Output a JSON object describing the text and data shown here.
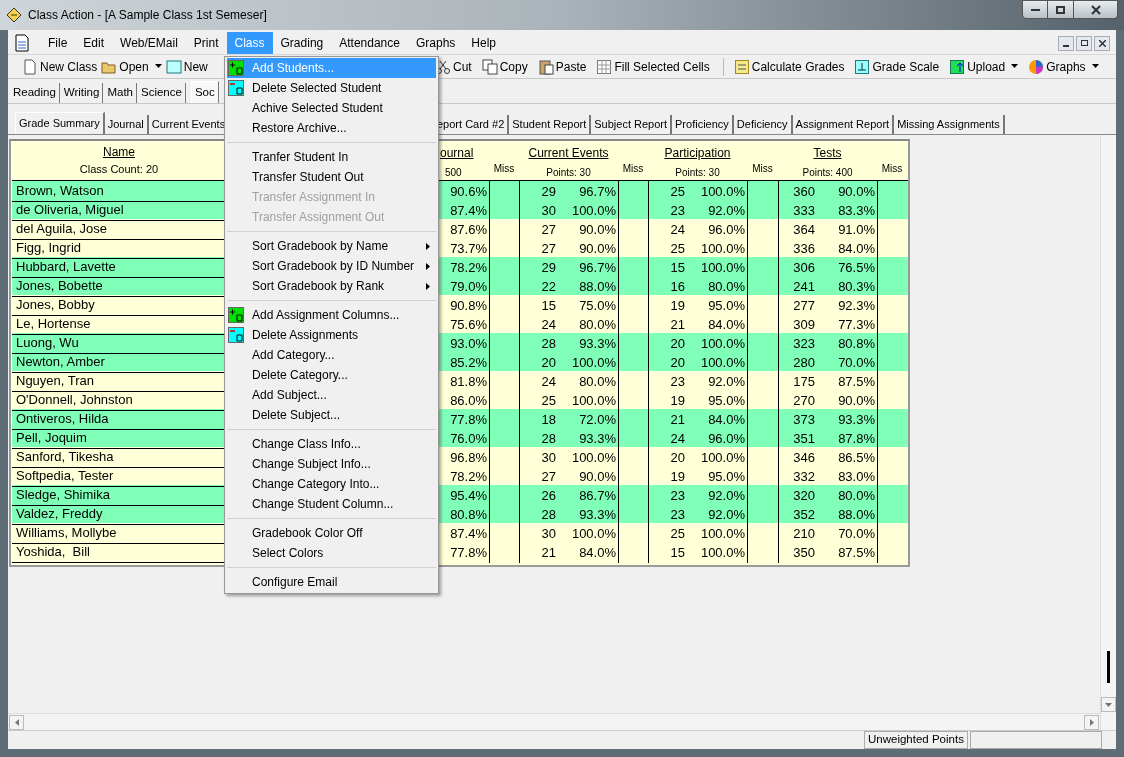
{
  "window": {
    "title": "Class Action - [A Sample Class 1st Semeser]"
  },
  "menubar": [
    {
      "label": "File",
      "selected": false
    },
    {
      "label": "Edit",
      "selected": false
    },
    {
      "label": "Web/EMail",
      "selected": false
    },
    {
      "label": "Print",
      "selected": false
    },
    {
      "label": "Class",
      "selected": true
    },
    {
      "label": "Grading",
      "selected": false
    },
    {
      "label": "Attendance",
      "selected": false
    },
    {
      "label": "Graphs",
      "selected": false
    },
    {
      "label": "Help",
      "selected": false
    }
  ],
  "toolbar": [
    {
      "kind": "button",
      "label": "New Class"
    },
    {
      "kind": "dropdown",
      "label": "Open"
    },
    {
      "kind": "button",
      "label": "New"
    },
    {
      "kind": "button",
      "label": "Cut"
    },
    {
      "kind": "button",
      "label": "Copy"
    },
    {
      "kind": "button",
      "label": "Paste"
    },
    {
      "kind": "button",
      "label": "Fill Selected Cells"
    },
    {
      "kind": "separator"
    },
    {
      "kind": "button",
      "label": "Calculate Grades"
    },
    {
      "kind": "button",
      "label": "Grade Scale"
    },
    {
      "kind": "dropdown",
      "label": "Upload"
    },
    {
      "kind": "dropdown",
      "label": "Graphs"
    }
  ],
  "subject_tabs": [
    {
      "label": "Reading",
      "selected": false
    },
    {
      "label": "Writing",
      "selected": false
    },
    {
      "label": "Math",
      "selected": false
    },
    {
      "label": "Science",
      "selected": false
    },
    {
      "label": "Soc",
      "selected": true
    }
  ],
  "report_tabs": [
    {
      "label": "Grade Summary",
      "selected": true
    },
    {
      "label": "Journal",
      "selected": false
    },
    {
      "label": "Current Events",
      "selected": false
    },
    {
      "label": "eport Card #2",
      "selected": false
    },
    {
      "label": "Student Report",
      "selected": false
    },
    {
      "label": "Subject Report",
      "selected": false
    },
    {
      "label": "Proficiency",
      "selected": false
    },
    {
      "label": "Deficiency",
      "selected": false
    },
    {
      "label": "Assignment Report",
      "selected": false
    },
    {
      "label": "Missing Assignments",
      "selected": false
    }
  ],
  "gradebook": {
    "name_header": "Name",
    "class_count": "Class Count: 20",
    "groups": [
      {
        "title": "ournal",
        "points": "500",
        "miss": "Miss"
      },
      {
        "title": "Current Events",
        "points": "Points: 30",
        "miss": "Miss"
      },
      {
        "title": "Participation",
        "points": "Points: 30",
        "miss": "Miss"
      },
      {
        "title": "Tests",
        "points": "Points: 400",
        "miss": "Miss"
      }
    ],
    "rows": [
      {
        "name": "Brown, Watson",
        "color": "#80ffb8",
        "journal_pct": "90.6%",
        "ce": [
          "29",
          "96.7%"
        ],
        "part": [
          "25",
          "100.0%"
        ],
        "tests": [
          "360",
          "90.0%"
        ]
      },
      {
        "name": "de Oliveria, Miguel",
        "color": "#80ffb8",
        "journal_pct": "87.4%",
        "ce": [
          "30",
          "100.0%"
        ],
        "part": [
          "23",
          "92.0%"
        ],
        "tests": [
          "333",
          "83.3%"
        ]
      },
      {
        "name": "del Aguila, Jose",
        "color": "#ffffd8",
        "journal_pct": "87.6%",
        "ce": [
          "27",
          "90.0%"
        ],
        "part": [
          "24",
          "96.0%"
        ],
        "tests": [
          "364",
          "91.0%"
        ]
      },
      {
        "name": "Figg, Ingrid",
        "color": "#ffffd8",
        "journal_pct": "73.7%",
        "ce": [
          "27",
          "90.0%"
        ],
        "part": [
          "25",
          "100.0%"
        ],
        "tests": [
          "336",
          "84.0%"
        ]
      },
      {
        "name": "Hubbard, Lavette",
        "color": "#80ffb8",
        "journal_pct": "78.2%",
        "ce": [
          "29",
          "96.7%"
        ],
        "part": [
          "15",
          "100.0%"
        ],
        "tests": [
          "306",
          "76.5%"
        ]
      },
      {
        "name": "Jones, Bobette",
        "color": "#80ffb8",
        "journal_pct": "79.0%",
        "ce": [
          "22",
          "88.0%"
        ],
        "part": [
          "16",
          "80.0%"
        ],
        "tests": [
          "241",
          "80.3%"
        ]
      },
      {
        "name": "Jones, Bobby",
        "color": "#ffffd8",
        "journal_pct": "90.8%",
        "ce": [
          "15",
          "75.0%"
        ],
        "part": [
          "19",
          "95.0%"
        ],
        "tests": [
          "277",
          "92.3%"
        ]
      },
      {
        "name": "Le, Hortense",
        "color": "#ffffd8",
        "journal_pct": "75.6%",
        "ce": [
          "24",
          "80.0%"
        ],
        "part": [
          "21",
          "84.0%"
        ],
        "tests": [
          "309",
          "77.3%"
        ]
      },
      {
        "name": "Luong, Wu",
        "color": "#80ffb8",
        "journal_pct": "93.0%",
        "ce": [
          "28",
          "93.3%"
        ],
        "part": [
          "20",
          "100.0%"
        ],
        "tests": [
          "323",
          "80.8%"
        ]
      },
      {
        "name": "Newton, Amber",
        "color": "#80ffb8",
        "journal_pct": "85.2%",
        "ce": [
          "20",
          "100.0%"
        ],
        "part": [
          "20",
          "100.0%"
        ],
        "tests": [
          "280",
          "70.0%"
        ]
      },
      {
        "name": "Nguyen, Tran",
        "color": "#ffffd8",
        "journal_pct": "81.8%",
        "ce": [
          "24",
          "80.0%"
        ],
        "part": [
          "23",
          "92.0%"
        ],
        "tests": [
          "175",
          "87.5%"
        ]
      },
      {
        "name": "O'Donnell, Johnston",
        "color": "#ffffd8",
        "journal_pct": "86.0%",
        "ce": [
          "25",
          "100.0%"
        ],
        "part": [
          "19",
          "95.0%"
        ],
        "tests": [
          "270",
          "90.0%"
        ]
      },
      {
        "name": "Ontiveros, Hilda",
        "color": "#80ffb8",
        "journal_pct": "77.8%",
        "ce": [
          "18",
          "72.0%"
        ],
        "part": [
          "21",
          "84.0%"
        ],
        "tests": [
          "373",
          "93.3%"
        ]
      },
      {
        "name": "Pell, Joquim",
        "color": "#80ffb8",
        "journal_pct": "76.0%",
        "ce": [
          "28",
          "93.3%"
        ],
        "part": [
          "24",
          "96.0%"
        ],
        "tests": [
          "351",
          "87.8%"
        ]
      },
      {
        "name": "Sanford, Tikesha",
        "color": "#ffffd8",
        "journal_pct": "96.8%",
        "ce": [
          "30",
          "100.0%"
        ],
        "part": [
          "20",
          "100.0%"
        ],
        "tests": [
          "346",
          "86.5%"
        ]
      },
      {
        "name": "Softpedia, Tester",
        "color": "#ffffd8",
        "journal_pct": "78.2%",
        "ce": [
          "27",
          "90.0%"
        ],
        "part": [
          "19",
          "95.0%"
        ],
        "tests": [
          "332",
          "83.0%"
        ]
      },
      {
        "name": "Sledge, Shimika",
        "color": "#80ffb8",
        "journal_pct": "95.4%",
        "ce": [
          "26",
          "86.7%"
        ],
        "part": [
          "23",
          "92.0%"
        ],
        "tests": [
          "320",
          "80.0%"
        ]
      },
      {
        "name": "Valdez, Freddy",
        "color": "#80ffb8",
        "journal_pct": "80.8%",
        "ce": [
          "28",
          "93.3%"
        ],
        "part": [
          "23",
          "92.0%"
        ],
        "tests": [
          "352",
          "88.0%"
        ]
      },
      {
        "name": "Williams, Mollybe",
        "color": "#ffffd8",
        "journal_pct": "87.4%",
        "ce": [
          "30",
          "100.0%"
        ],
        "part": [
          "25",
          "100.0%"
        ],
        "tests": [
          "210",
          "70.0%"
        ]
      },
      {
        "name": "Yoshida,  Bill",
        "color": "#ffffd8",
        "journal_pct": "77.8%",
        "ce": [
          "21",
          "84.0%"
        ],
        "part": [
          "15",
          "100.0%"
        ],
        "tests": [
          "350",
          "87.5%"
        ]
      }
    ]
  },
  "class_menu": [
    {
      "kind": "item",
      "label": "Add Students...",
      "selected": true,
      "disabled": false,
      "submenu": false
    },
    {
      "kind": "item",
      "label": "Delete Selected Student",
      "selected": false,
      "disabled": false,
      "submenu": false
    },
    {
      "kind": "item",
      "label": "Achive Selected Student",
      "selected": false,
      "disabled": false,
      "submenu": false
    },
    {
      "kind": "item",
      "label": "Restore Archive...",
      "selected": false,
      "disabled": false,
      "submenu": false
    },
    {
      "kind": "separator"
    },
    {
      "kind": "item",
      "label": "Tranfer Student In",
      "selected": false,
      "disabled": false,
      "submenu": false
    },
    {
      "kind": "item",
      "label": "Transfer Student Out",
      "selected": false,
      "disabled": false,
      "submenu": false
    },
    {
      "kind": "item",
      "label": "Transfer Assignment In",
      "selected": false,
      "disabled": true,
      "submenu": false
    },
    {
      "kind": "item",
      "label": "Transfer Assignment Out",
      "selected": false,
      "disabled": true,
      "submenu": false
    },
    {
      "kind": "separator"
    },
    {
      "kind": "item",
      "label": "Sort Gradebook by Name",
      "selected": false,
      "disabled": false,
      "submenu": true
    },
    {
      "kind": "item",
      "label": "Sort Gradebook by ID Number",
      "selected": false,
      "disabled": false,
      "submenu": true
    },
    {
      "kind": "item",
      "label": "Sort Gradebook by Rank",
      "selected": false,
      "disabled": false,
      "submenu": true
    },
    {
      "kind": "separator"
    },
    {
      "kind": "item",
      "label": "Add Assignment Columns...",
      "selected": false,
      "disabled": false,
      "submenu": false
    },
    {
      "kind": "item",
      "label": "Delete Assignments",
      "selected": false,
      "disabled": false,
      "submenu": false
    },
    {
      "kind": "item",
      "label": "Add Category...",
      "selected": false,
      "disabled": false,
      "submenu": false
    },
    {
      "kind": "item",
      "label": "Delete Category...",
      "selected": false,
      "disabled": false,
      "submenu": false
    },
    {
      "kind": "item",
      "label": "Add Subject...",
      "selected": false,
      "disabled": false,
      "submenu": false
    },
    {
      "kind": "item",
      "label": "Delete Subject...",
      "selected": false,
      "disabled": false,
      "submenu": false
    },
    {
      "kind": "separator"
    },
    {
      "kind": "item",
      "label": "Change Class Info...",
      "selected": false,
      "disabled": false,
      "submenu": false
    },
    {
      "kind": "item",
      "label": "Change Subject Info...",
      "selected": false,
      "disabled": false,
      "submenu": false
    },
    {
      "kind": "item",
      "label": "Change Category Into...",
      "selected": false,
      "disabled": false,
      "submenu": false
    },
    {
      "kind": "item",
      "label": "Change Student Column...",
      "selected": false,
      "disabled": false,
      "submenu": false
    },
    {
      "kind": "separator"
    },
    {
      "kind": "item",
      "label": "Gradebook Color Off",
      "selected": false,
      "disabled": false,
      "submenu": false
    },
    {
      "kind": "item",
      "label": "Select Colors",
      "selected": false,
      "disabled": false,
      "submenu": false
    },
    {
      "kind": "separator"
    },
    {
      "kind": "item",
      "label": "Configure Email",
      "selected": false,
      "disabled": false,
      "submenu": false
    }
  ],
  "status_bar": {
    "mode": "Unweighted Points"
  }
}
